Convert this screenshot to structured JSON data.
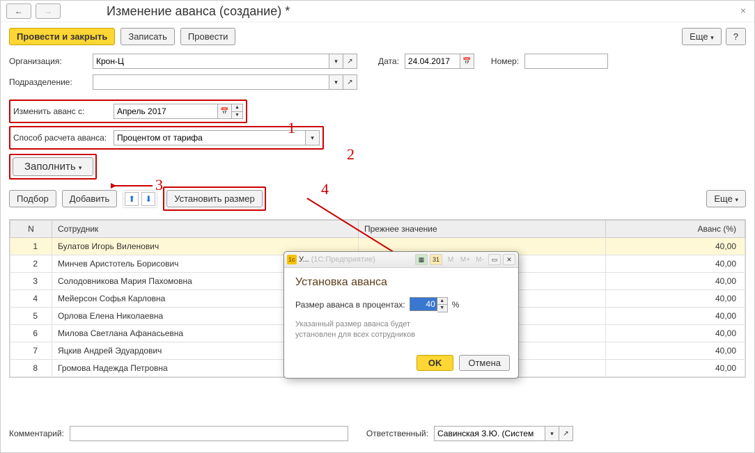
{
  "title": "Изменение аванса (создание) *",
  "toolbar": {
    "primary": "Провести и закрыть",
    "write": "Записать",
    "post": "Провести",
    "more": "Еще",
    "help": "?"
  },
  "fields": {
    "org_label": "Организация:",
    "org_value": "Крон-Ц",
    "date_label": "Дата:",
    "date_value": "24.04.2017",
    "num_label": "Номер:",
    "num_value": "",
    "dept_label": "Подразделение:",
    "dept_value": "",
    "change_from_label": "Изменить аванс с:",
    "change_from_value": "Апрель 2017",
    "calc_method_label": "Способ расчета аванса:",
    "calc_method_value": "Процентом от тарифа",
    "fill": "Заполнить",
    "pick": "Подбор",
    "add": "Добавить",
    "set_size": "Установить размер",
    "more2": "Еще"
  },
  "annotations": {
    "a1": "1",
    "a2": "2",
    "a3": "3",
    "a4": "4"
  },
  "table": {
    "cols": {
      "n": "N",
      "emp": "Сотрудник",
      "prev": "Прежнее значение",
      "av": "Аванс (%)"
    },
    "rows": [
      {
        "n": "1",
        "emp": "Булатов Игорь Виленович",
        "av": "40,00"
      },
      {
        "n": "2",
        "emp": "Минчев Аристотель Борисович",
        "av": "40,00"
      },
      {
        "n": "3",
        "emp": "Солодовникова Мария Пахомовна",
        "av": "40,00"
      },
      {
        "n": "4",
        "emp": "Мейерсон Софья Карловна",
        "av": "40,00"
      },
      {
        "n": "5",
        "emp": "Орлова Елена Николаевна",
        "av": "40,00"
      },
      {
        "n": "6",
        "emp": "Милова Светлана Афанасьевна",
        "av": "40,00"
      },
      {
        "n": "7",
        "emp": "Яцкив Андрей Эдуардович",
        "av": "40,00"
      },
      {
        "n": "8",
        "emp": "Громова Надежда Петровна",
        "av": "40,00"
      }
    ]
  },
  "footer": {
    "comment_label": "Комментарий:",
    "comment_value": "",
    "resp_label": "Ответственный:",
    "resp_value": "Савинская З.Ю. (Систем"
  },
  "dialog": {
    "title_short": "У...",
    "title_app": "(1С:Предприятие)",
    "m": "M",
    "mplus": "M+",
    "mminus": "M-",
    "heading": "Установка аванса",
    "size_label": "Размер аванса в процентах:",
    "value": "40",
    "unit": "%",
    "hint1": "Указанный размер аванса будет",
    "hint2": "установлен для всех сотрудников",
    "ok": "OK",
    "cancel": "Отмена"
  }
}
